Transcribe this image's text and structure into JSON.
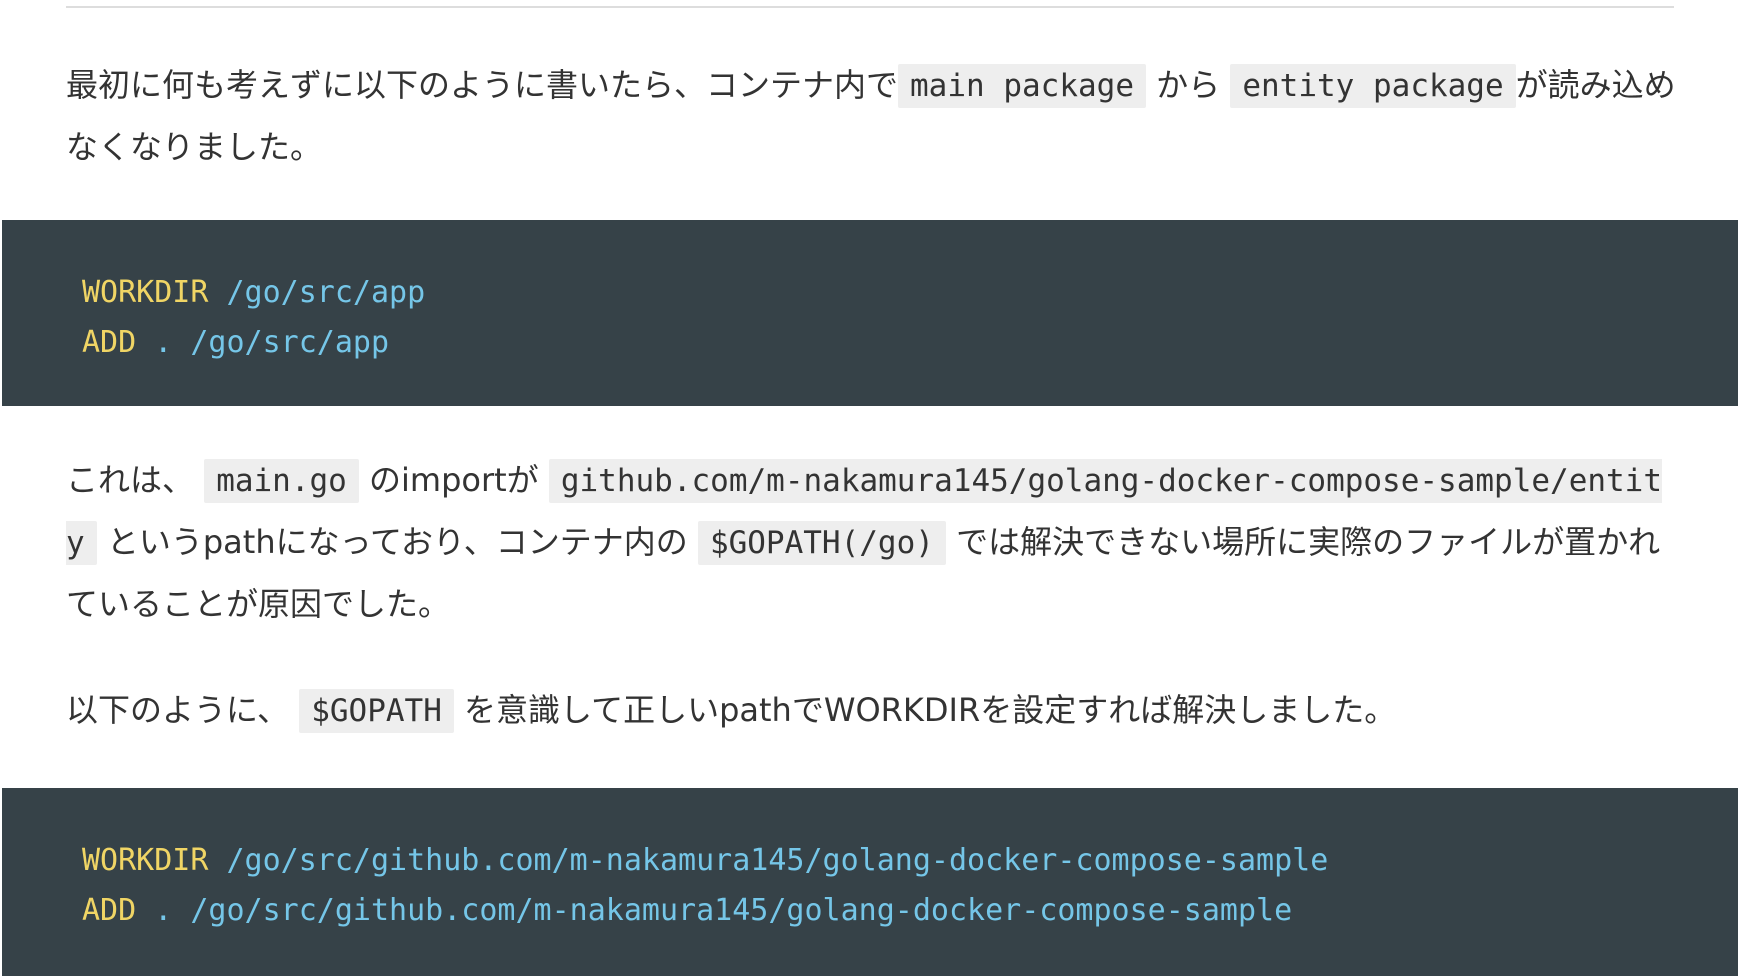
{
  "paragraph1": {
    "text_a": "最初に何も考えずに以下のように書いたら、コンテナ内で",
    "code_a": "main package",
    "text_b": " から ",
    "code_b": "entity package",
    "text_c": "が読み込めなくなりました。"
  },
  "codeblock1": {
    "lines": [
      {
        "keyword": "WORKDIR",
        "arg": "/go/src/app"
      },
      {
        "keyword": "ADD",
        "dot": ".",
        "arg": "/go/src/app"
      }
    ]
  },
  "paragraph2": {
    "text_a": "これは、 ",
    "code_a": "main.go",
    "text_b": " のimportが ",
    "code_b": "github.com/m-nakamura145/golang-docker-compose-sample/entity",
    "text_c": " というpathになっており、コンテナ内の ",
    "code_c": "$GOPATH(/go)",
    "text_d": " では解決できない場所に実際のファイルが置かれていることが原因でした。"
  },
  "paragraph3": {
    "text_a": "以下のように、 ",
    "code_a": "$GOPATH",
    "text_b": " を意識して正しいpathでWORKDIRを設定すれば解決しました。"
  },
  "codeblock2": {
    "lines": [
      {
        "keyword": "WORKDIR",
        "arg": "/go/src/github.com/m-nakamura145/golang-docker-compose-sample"
      },
      {
        "keyword": "ADD",
        "dot": ".",
        "arg": "/go/src/github.com/m-nakamura145/golang-docker-compose-sample"
      }
    ]
  },
  "colors": {
    "code_block_bg": "#364248",
    "keyword": "#f0d565",
    "path": "#75c6e8",
    "inline_code_bg": "#eeeeee"
  }
}
